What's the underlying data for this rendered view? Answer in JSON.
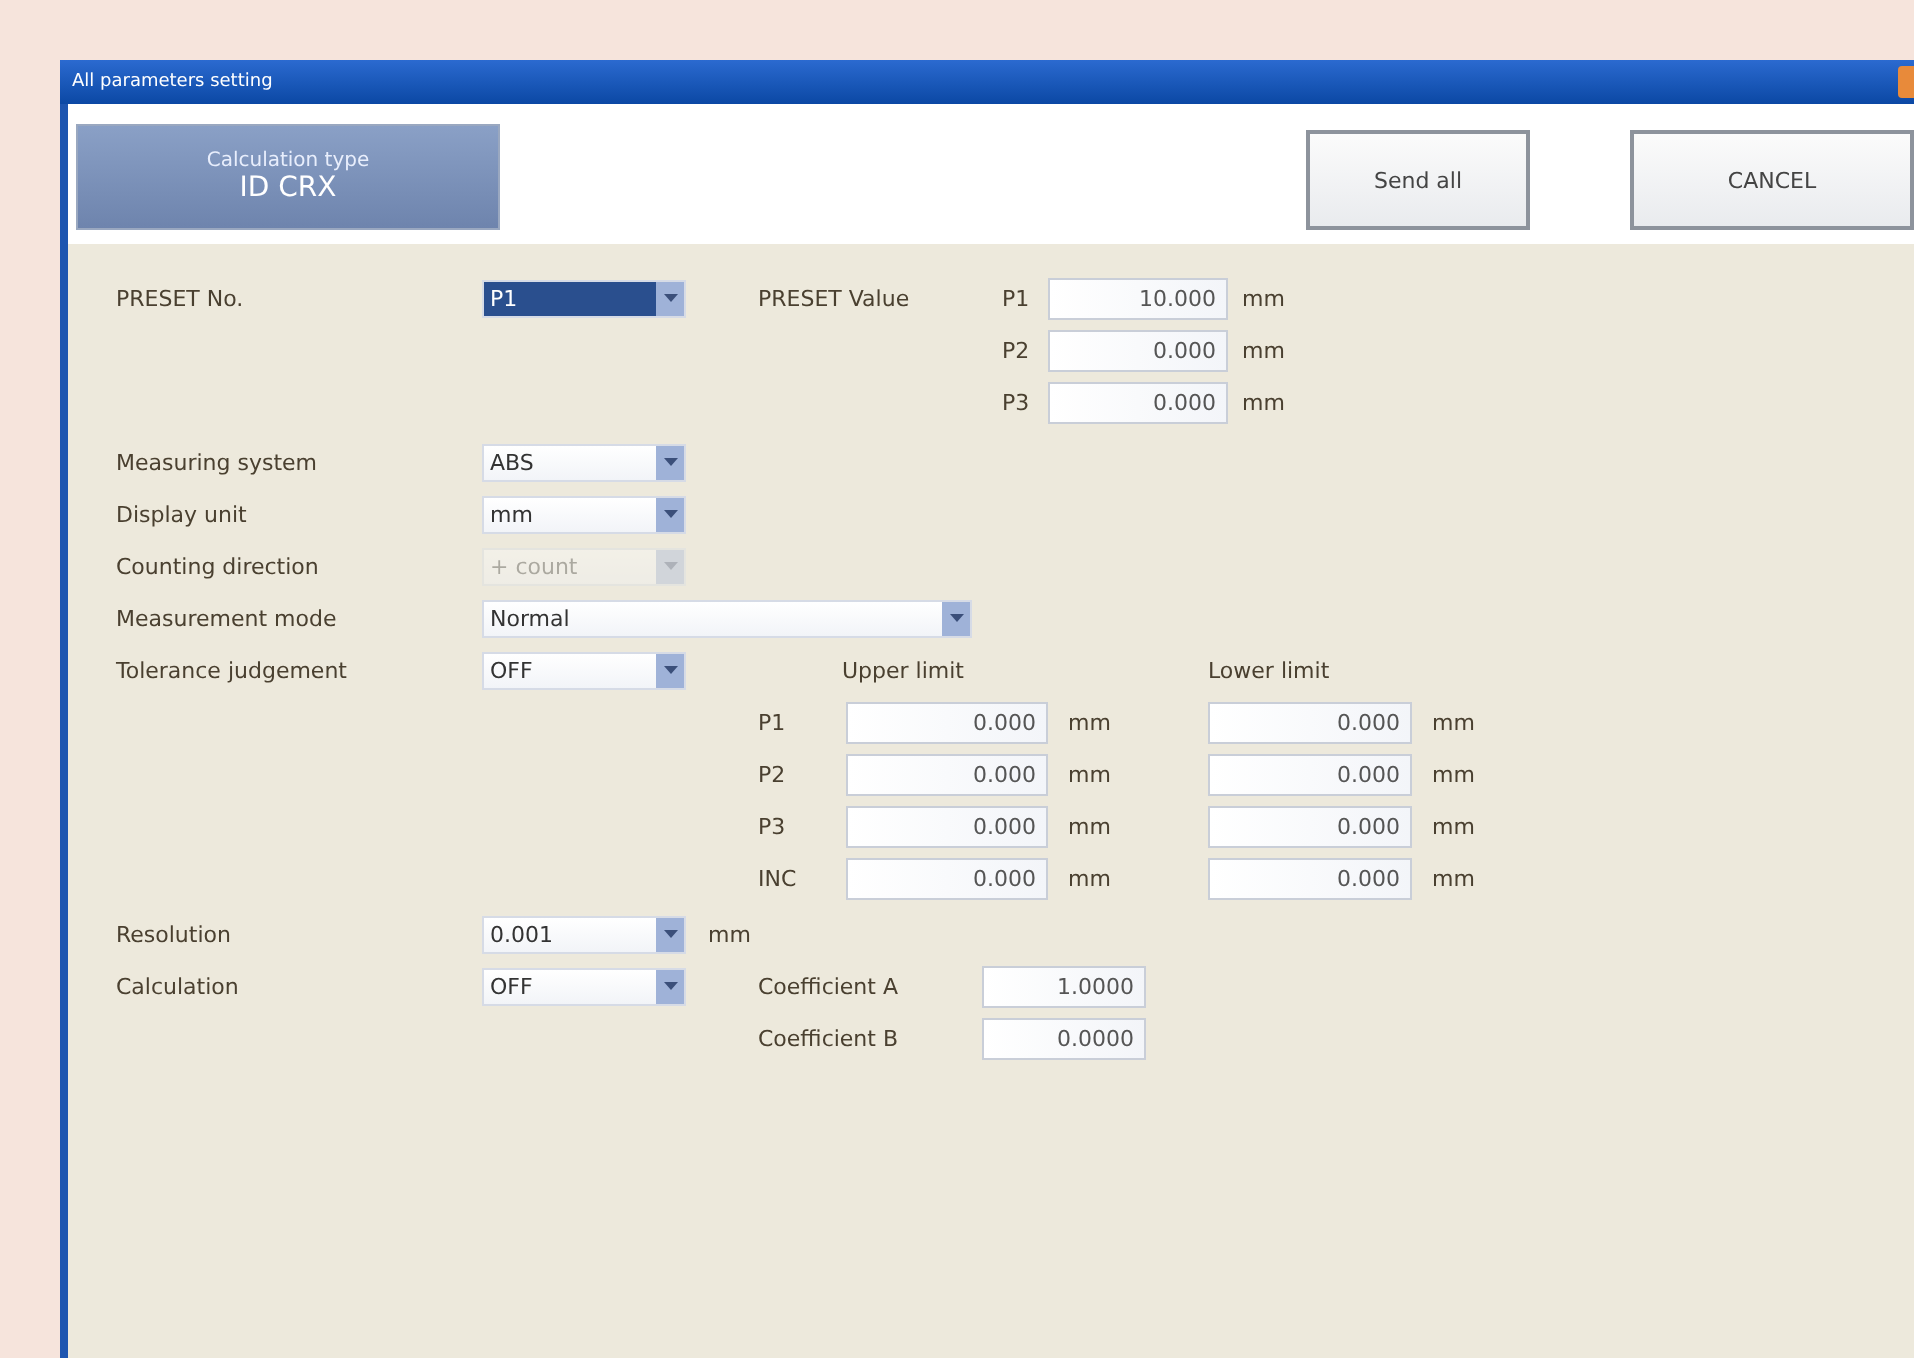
{
  "window": {
    "title": "All parameters setting"
  },
  "calculation_type": {
    "label": "Calculation type",
    "value": "ID CRX"
  },
  "buttons": [
    "Send all",
    "CANCEL"
  ],
  "preset": {
    "label": "PRESET No.",
    "value": "P1",
    "value_label": "PRESET Value",
    "values": [
      {
        "name": "P1",
        "value": "10.000",
        "unit": "mm"
      },
      {
        "name": "P2",
        "value": "0.000",
        "unit": "mm"
      },
      {
        "name": "P3",
        "value": "0.000",
        "unit": "mm"
      }
    ]
  },
  "settings": [
    {
      "label": "Measuring system",
      "value": "ABS",
      "kind": "combo",
      "disabled": false
    },
    {
      "label": "Display unit",
      "value": "mm",
      "kind": "combo",
      "disabled": false
    },
    {
      "label": "Counting direction",
      "value": "+ count",
      "kind": "combo",
      "disabled": true
    },
    {
      "label": "Measurement mode",
      "value": "Normal",
      "kind": "wide_combo",
      "disabled": false
    }
  ],
  "tolerance": {
    "label": "Tolerance judgement",
    "value": "OFF",
    "upper_label": "Upper limit",
    "lower_label": "Lower limit",
    "rows": [
      {
        "name": "P1",
        "upper": "0.000",
        "upper_unit": "mm",
        "lower": "0.000",
        "lower_unit": "mm"
      },
      {
        "name": "P2",
        "upper": "0.000",
        "upper_unit": "mm",
        "lower": "0.000",
        "lower_unit": "mm"
      },
      {
        "name": "P3",
        "upper": "0.000",
        "upper_unit": "mm",
        "lower": "0.000",
        "lower_unit": "mm"
      },
      {
        "name": "INC",
        "upper": "0.000",
        "upper_unit": "mm",
        "lower": "0.000",
        "lower_unit": "mm"
      }
    ]
  },
  "resolution": {
    "label": "Resolution",
    "value": "0.001",
    "unit": "mm"
  },
  "calculation": {
    "label": "Calculation",
    "value": "OFF",
    "coefficients": [
      {
        "name": "Coefficient A",
        "value": "1.0000"
      },
      {
        "name": "Coefficient B",
        "value": "0.0000"
      }
    ]
  }
}
